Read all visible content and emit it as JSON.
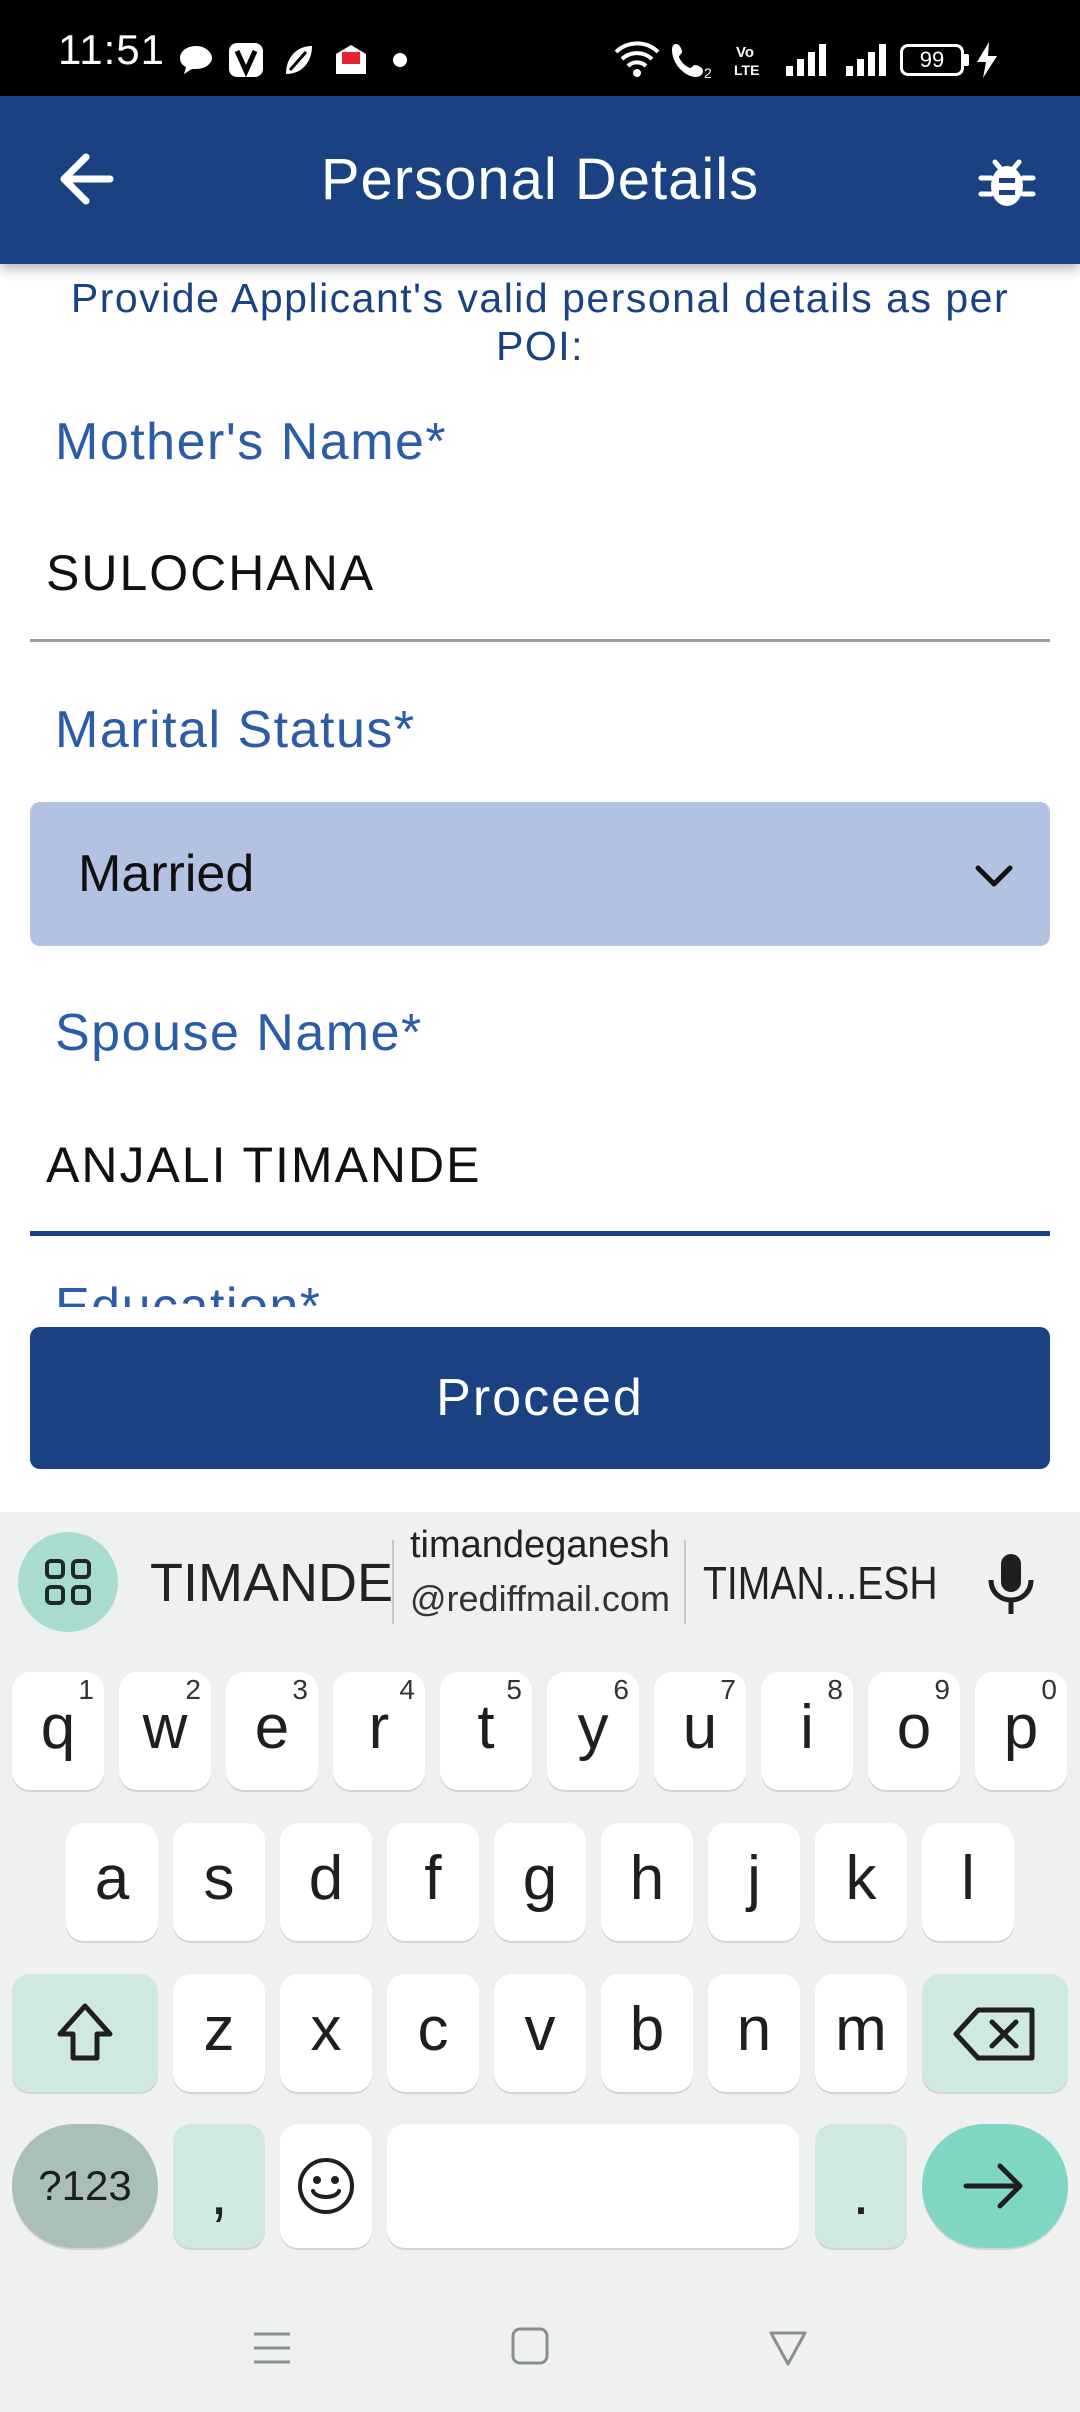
{
  "status_bar": {
    "time": "11:51",
    "battery": "99",
    "notification_icons": [
      "chat-bubble-icon",
      "v-app-icon",
      "leaf-app-icon",
      "mail-icon",
      "dot-icon"
    ],
    "system_icons": [
      "wifi-icon",
      "volte-call-icon",
      "lte-icon",
      "signal-icon",
      "signal-icon",
      "battery-icon",
      "charging-icon"
    ]
  },
  "app_bar": {
    "title": "Personal Details",
    "color": "#1a4282"
  },
  "form": {
    "intro": "Provide Applicant's valid personal details as per POI:",
    "mother_name": {
      "label": "Mother's Name*",
      "value": "SULOCHANA"
    },
    "marital_status": {
      "label": "Marital Status*",
      "selected": "Married"
    },
    "spouse_name": {
      "label": "Spouse Name*",
      "value": "ANJALI TIMANDE"
    },
    "education": {
      "label": "Education*"
    },
    "proceed_label": "Proceed"
  },
  "keyboard": {
    "suggestions": [
      "TIMANDE",
      "timandeganesh",
      "@rediffmail.com",
      "TIMAN...ESH"
    ],
    "row1": [
      "q",
      "w",
      "e",
      "r",
      "t",
      "y",
      "u",
      "i",
      "o",
      "p"
    ],
    "row1_hints": [
      "1",
      "2",
      "3",
      "4",
      "5",
      "6",
      "7",
      "8",
      "9",
      "0"
    ],
    "row2": [
      "a",
      "s",
      "d",
      "f",
      "g",
      "h",
      "j",
      "k",
      "l"
    ],
    "row3": [
      "z",
      "x",
      "c",
      "v",
      "b",
      "n",
      "m"
    ],
    "symbols_label": "?123",
    "comma": ",",
    "period": "."
  }
}
